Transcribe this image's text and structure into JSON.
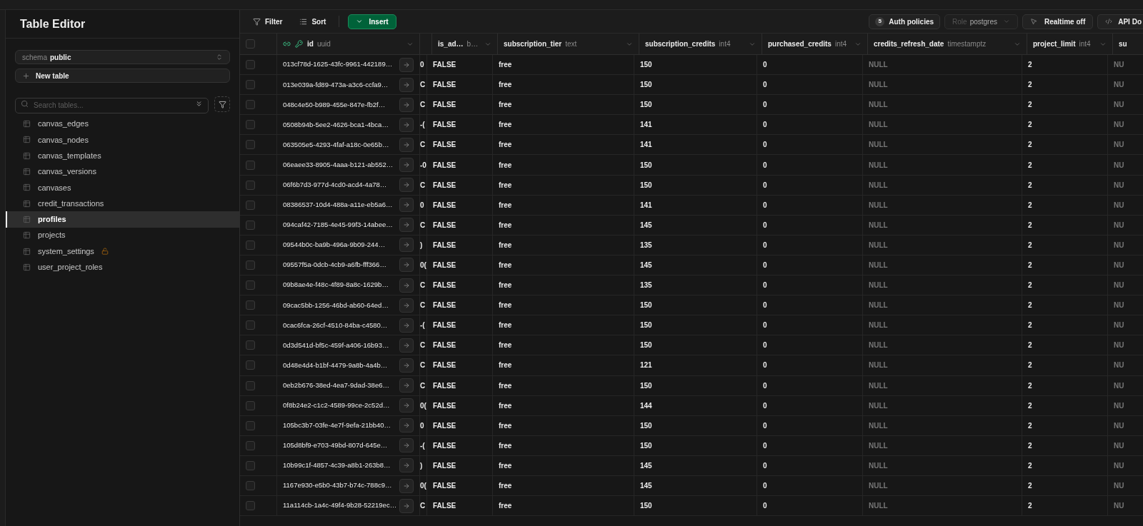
{
  "sidebar": {
    "title": "Table Editor",
    "schema": {
      "label": "schema",
      "value": "public"
    },
    "new_table": "New table",
    "search": {
      "placeholder": "Search tables..."
    },
    "tables": [
      {
        "name": "canvas_edges",
        "selected": false,
        "locked": false
      },
      {
        "name": "canvas_nodes",
        "selected": false,
        "locked": false
      },
      {
        "name": "canvas_templates",
        "selected": false,
        "locked": false
      },
      {
        "name": "canvas_versions",
        "selected": false,
        "locked": false
      },
      {
        "name": "canvases",
        "selected": false,
        "locked": false
      },
      {
        "name": "credit_transactions",
        "selected": false,
        "locked": false
      },
      {
        "name": "profiles",
        "selected": true,
        "locked": false
      },
      {
        "name": "projects",
        "selected": false,
        "locked": false
      },
      {
        "name": "system_settings",
        "selected": false,
        "locked": true
      },
      {
        "name": "user_project_roles",
        "selected": false,
        "locked": false
      }
    ]
  },
  "toolbar": {
    "filter": "Filter",
    "sort": "Sort",
    "insert": "Insert",
    "auth_policies": {
      "count": "5",
      "label": "Auth policies"
    },
    "role": {
      "label": "Role",
      "value": "postgres"
    },
    "realtime": "Realtime off",
    "api_docs": "API Do"
  },
  "table": {
    "all_selected": false,
    "columns": [
      {
        "kind": "key",
        "name": "id",
        "type": "uuid"
      },
      {
        "kind": "sliver"
      },
      {
        "kind": "plain",
        "name": "is_ad…",
        "type": "b…"
      },
      {
        "kind": "plain",
        "name": "subscription_tier",
        "type": "text"
      },
      {
        "kind": "plain",
        "name": "subscription_credits",
        "type": "int4"
      },
      {
        "kind": "plain",
        "name": "purchased_credits",
        "type": "int4"
      },
      {
        "kind": "null",
        "name": "credits_refresh_date",
        "type": "timestamptz"
      },
      {
        "kind": "plain",
        "name": "project_limit",
        "type": "int4"
      },
      {
        "kind": "null",
        "name": "su"
      }
    ],
    "rows": [
      {
        "selected": false,
        "cells": [
          "013cf78d-1625-43fc-9961-442189…",
          "0",
          "FALSE",
          "free",
          "150",
          "0",
          "NULL",
          "2",
          "NU"
        ]
      },
      {
        "selected": false,
        "cells": [
          "013e039a-fd89-473a-a3c6-ccfa9…",
          "C",
          "FALSE",
          "free",
          "150",
          "0",
          "NULL",
          "2",
          "NU"
        ]
      },
      {
        "selected": false,
        "cells": [
          "048c4e50-b989-455e-847e-fb2f…",
          "C",
          "FALSE",
          "free",
          "150",
          "0",
          "NULL",
          "2",
          "NU"
        ]
      },
      {
        "selected": false,
        "cells": [
          "0508b94b-5ee2-4626-bca1-4bca…",
          "-(",
          "FALSE",
          "free",
          "141",
          "0",
          "NULL",
          "2",
          "NU"
        ]
      },
      {
        "selected": false,
        "cells": [
          "063505e5-4293-4faf-a18c-0e65b…",
          "C",
          "FALSE",
          "free",
          "141",
          "0",
          "NULL",
          "2",
          "NU"
        ]
      },
      {
        "selected": false,
        "cells": [
          "06eaee33-8905-4aaa-b121-ab552…",
          "-0",
          "FALSE",
          "free",
          "150",
          "0",
          "NULL",
          "2",
          "NU"
        ]
      },
      {
        "selected": false,
        "cells": [
          "06f6b7d3-977d-4cd0-acd4-4a78…",
          "C",
          "FALSE",
          "free",
          "150",
          "0",
          "NULL",
          "2",
          "NU"
        ]
      },
      {
        "selected": false,
        "cells": [
          "08386537-10d4-488a-a11e-eb5a6…",
          "0",
          "FALSE",
          "free",
          "141",
          "0",
          "NULL",
          "2",
          "NU"
        ]
      },
      {
        "selected": false,
        "cells": [
          "094caf42-7185-4e45-99f3-14abee…",
          "C",
          "FALSE",
          "free",
          "145",
          "0",
          "NULL",
          "2",
          "NU"
        ]
      },
      {
        "selected": false,
        "cells": [
          "09544b0c-ba9b-496a-9b09-244…",
          ")",
          "FALSE",
          "free",
          "135",
          "0",
          "NULL",
          "2",
          "NU"
        ]
      },
      {
        "selected": false,
        "cells": [
          "09557f5a-0dcb-4cb9-a6fb-fff366…",
          "0(",
          "FALSE",
          "free",
          "145",
          "0",
          "NULL",
          "2",
          "NU"
        ]
      },
      {
        "selected": false,
        "cells": [
          "09b8ae4e-f48c-4f89-8a8c-1629b…",
          "C",
          "FALSE",
          "free",
          "135",
          "0",
          "NULL",
          "2",
          "NU"
        ]
      },
      {
        "selected": false,
        "cells": [
          "09cac5bb-1256-46bd-ab60-64ed…",
          "C",
          "FALSE",
          "free",
          "150",
          "0",
          "NULL",
          "2",
          "NU"
        ]
      },
      {
        "selected": false,
        "cells": [
          "0cac6fca-26cf-4510-84ba-c4580…",
          "-(",
          "FALSE",
          "free",
          "150",
          "0",
          "NULL",
          "2",
          "NU"
        ]
      },
      {
        "selected": false,
        "cells": [
          "0d3d541d-bf5c-459f-a406-16b93…",
          "C",
          "FALSE",
          "free",
          "150",
          "0",
          "NULL",
          "2",
          "NU"
        ]
      },
      {
        "selected": false,
        "cells": [
          "0d48e4d4-b1bf-4479-9a8b-4a4b…",
          "C",
          "FALSE",
          "free",
          "121",
          "0",
          "NULL",
          "2",
          "NU"
        ]
      },
      {
        "selected": false,
        "cells": [
          "0eb2b676-38ed-4ea7-9dad-38e6…",
          "C",
          "FALSE",
          "free",
          "150",
          "0",
          "NULL",
          "2",
          "NU"
        ]
      },
      {
        "selected": false,
        "cells": [
          "0f8b24e2-c1c2-4589-99ce-2c52d…",
          "0(",
          "FALSE",
          "free",
          "144",
          "0",
          "NULL",
          "2",
          "NU"
        ]
      },
      {
        "selected": false,
        "cells": [
          "105bc3b7-03fe-4e7f-9efa-21bb40…",
          "0",
          "FALSE",
          "free",
          "150",
          "0",
          "NULL",
          "2",
          "NU"
        ]
      },
      {
        "selected": false,
        "cells": [
          "105d8bf9-e703-49bd-807d-645e…",
          "-(",
          "FALSE",
          "free",
          "150",
          "0",
          "NULL",
          "2",
          "NU"
        ]
      },
      {
        "selected": false,
        "cells": [
          "10b99c1f-4857-4c39-a8b1-263b8…",
          ")",
          "FALSE",
          "free",
          "145",
          "0",
          "NULL",
          "2",
          "NU"
        ]
      },
      {
        "selected": false,
        "cells": [
          "1167e930-e5b0-43b7-b74c-788c9…",
          "0(",
          "FALSE",
          "free",
          "145",
          "0",
          "NULL",
          "2",
          "NU"
        ]
      },
      {
        "selected": false,
        "cells": [
          "11a114cb-1a4c-49f4-9b28-52219ec…",
          "C",
          "FALSE",
          "free",
          "150",
          "0",
          "NULL",
          "2",
          "NU"
        ]
      }
    ]
  }
}
